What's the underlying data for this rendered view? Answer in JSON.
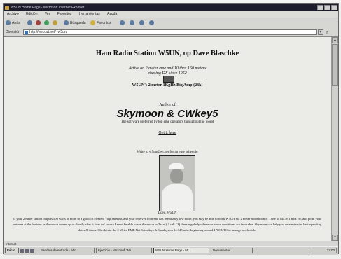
{
  "window": {
    "title": "W5UN Home Page - Microsoft Internet Explorer"
  },
  "menu": [
    "Archivo",
    "Edición",
    "Ver",
    "Favoritos",
    "Herramientas",
    "Ayuda"
  ],
  "toolbar": {
    "back": "Atrás",
    "search": "Búsqueda",
    "favorites": "Favoritos"
  },
  "address": {
    "label": "Dirección",
    "url": "http://web.wt.net/~w5un/",
    "go": "Ir"
  },
  "page": {
    "title": "Ham Radio Station W5UN, op Dave Blaschke",
    "active": "Active on 2 meter eme and 10 thru 160 meters",
    "chasing": "chasing DX since 1952",
    "amp": "W5UN's 2 meter 1KgHz Big Amp (23k)",
    "author": "Author of",
    "skymoon": "Skymoon & CWkey5",
    "software": "The software preferred by top eme operators throughout the world",
    "getit": "Get it here",
    "write": "Write to w5un@wt.net for an eme schedule",
    "caption": "Dave, W5UN",
    "paragraph": "If your 2 meter station outputs 500 watts or more to a good 16 element Yagi antenna, and your receiver front end has reasonably low noise, you may be able to work W5UN via 2 meter moonbounce. Tune to 144.041 mhz cw, and point your antenna at the horizon as the moon comes up or shortly after it rises (of course I must be able to see the moon in Texas). I call CQ there regularly whenever moon conditions are favorable. Skymoon can help you determine the best operating dates & times. Check into the 2 Meter EME Net Saturdays & Sundays on 14.345 mhz, beginning around 1700 UTC to arrange a schedule."
  },
  "status": {
    "text": "Internet"
  },
  "taskbar": {
    "start": "Inicio",
    "tasks": [
      "Bandeja de entrada - Mic...",
      "Ejercicio - Microsoft Wo...",
      "W5UN Home Page - Mi...",
      "Documentos"
    ],
    "clock": "12:00"
  }
}
